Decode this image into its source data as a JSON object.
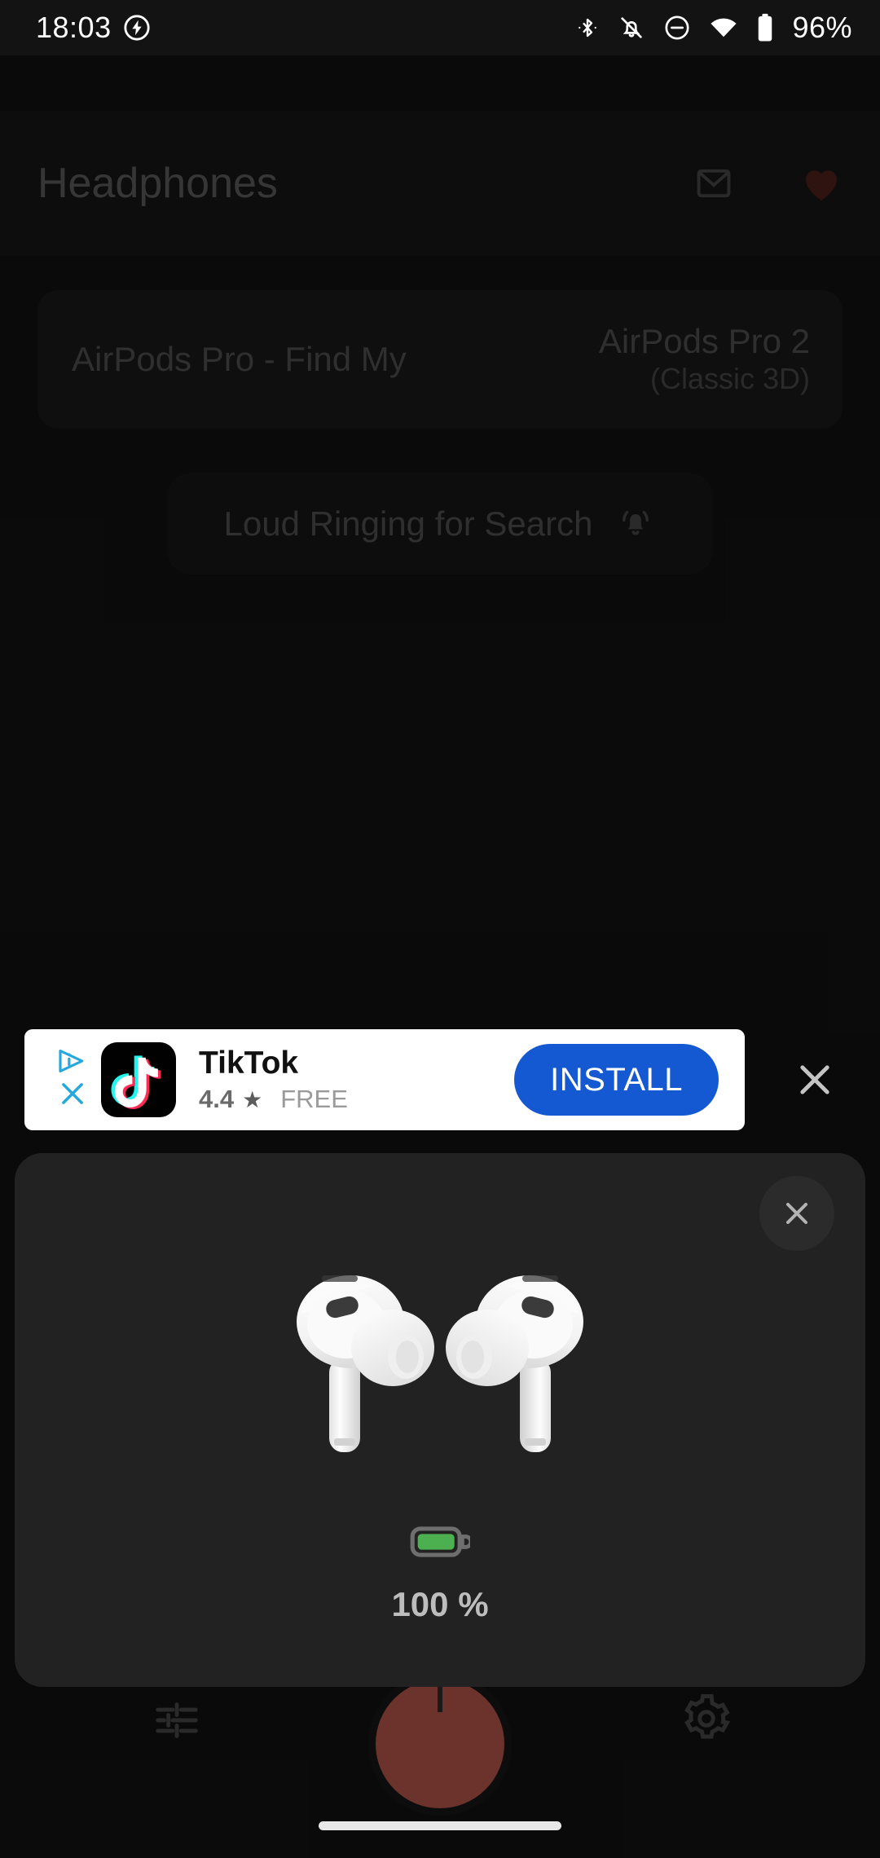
{
  "status_bar": {
    "time": "18:03",
    "battery_percent": "96%",
    "icons": [
      "charging-bolt-icon",
      "bluetooth-icon",
      "notifications-muted-icon",
      "do-not-disturb-icon",
      "wifi-icon",
      "battery-icon"
    ]
  },
  "header": {
    "title": "Headphones",
    "mail_icon": "mail-icon",
    "favorite_icon": "heart-icon",
    "favorite_color": "#7a332c"
  },
  "device_card": {
    "left_label": "AirPods Pro - Find My",
    "model": "AirPods Pro 2",
    "mode": "(Classic 3D)"
  },
  "ring_pill": {
    "label": "Loud Ringing for Search",
    "icon": "ringing-bell-icon"
  },
  "ad": {
    "adchoices_icon": "adchoices-icon",
    "close_icon": "close-icon",
    "app_name": "TikTok",
    "rating": "4.4",
    "star": "★",
    "price": "FREE",
    "install_label": "INSTALL",
    "install_color": "#1458d2",
    "logo": "tiktok-logo"
  },
  "modal": {
    "close_icon": "close-icon",
    "product_image": "airpods-pro-2-image",
    "battery_icon": "battery-full-icon",
    "battery_color": "#4caf50",
    "battery_percent": "100 %"
  },
  "bottom_nav": {
    "equalizer_icon": "equalizer-icon",
    "settings_icon": "gear-icon",
    "fab_icon": "record-fab",
    "fab_color": "#6b332c"
  }
}
